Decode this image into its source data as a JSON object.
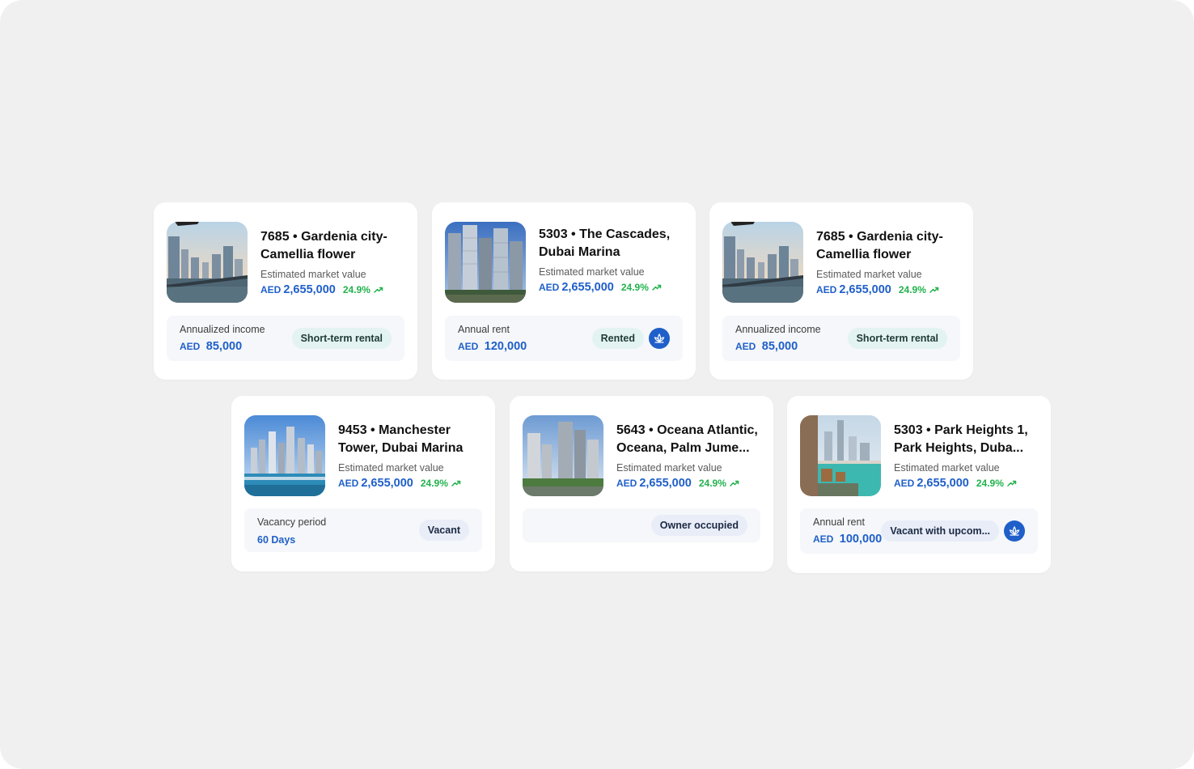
{
  "cards": [
    {
      "title": "7685 • Gardenia city- Camellia flower",
      "est_label": "Estimated market value",
      "currency": "AED",
      "amount": "2,655,000",
      "change": "24.9%",
      "bottom_label": "Annualized income",
      "bottom_currency": "AED",
      "bottom_value": "85,000",
      "status": "Short-term rental",
      "image": "city-balcony-sunset"
    },
    {
      "title": "5303 • The Cascades, Dubai Marina",
      "est_label": "Estimated market value",
      "currency": "AED",
      "amount": "2,655,000",
      "change": "24.9%",
      "bottom_label": "Annual rent",
      "bottom_currency": "AED",
      "bottom_value": "120,000",
      "status": "Rented",
      "badge_icon": "lotus-icon",
      "image": "glass-towers"
    },
    {
      "title": "7685 • Gardenia city- Camellia flower",
      "est_label": "Estimated market value",
      "currency": "AED",
      "amount": "2,655,000",
      "change": "24.9%",
      "bottom_label": "Annualized income",
      "bottom_currency": "AED",
      "bottom_value": "85,000",
      "status": "Short-term rental",
      "image": "city-balcony-sunset"
    },
    {
      "title": "9453 • Manchester Tower, Dubai Marina",
      "est_label": "Estimated market value",
      "currency": "AED",
      "amount": "2,655,000",
      "change": "24.9%",
      "bottom_label": "Vacancy period",
      "bottom_value": "60 Days",
      "status": "Vacant",
      "image": "marina-skyline"
    },
    {
      "title": "5643 • Oceana Atlantic, Oceana, Palm Jume...",
      "est_label": "Estimated market value",
      "currency": "AED",
      "amount": "2,655,000",
      "change": "24.9%",
      "status": "Owner occupied",
      "image": "palm-towers"
    },
    {
      "title": "5303 • Park Heights 1, Park Heights, Duba...",
      "est_label": "Estimated market value",
      "currency": "AED",
      "amount": "2,655,000",
      "change": "24.9%",
      "bottom_label": "Annual rent",
      "bottom_currency": "AED",
      "bottom_value": "100,000",
      "status": "Vacant with upcom...",
      "badge_icon": "lotus-icon",
      "image": "balcony-pool"
    }
  ],
  "colors": {
    "accent_blue": "#1f5fc9",
    "growth_green": "#22b24c",
    "status_teal_bg": "#e3f3f1",
    "status_blue_bg": "#e8edf8",
    "canvas_bg": "#f0f0f0"
  }
}
